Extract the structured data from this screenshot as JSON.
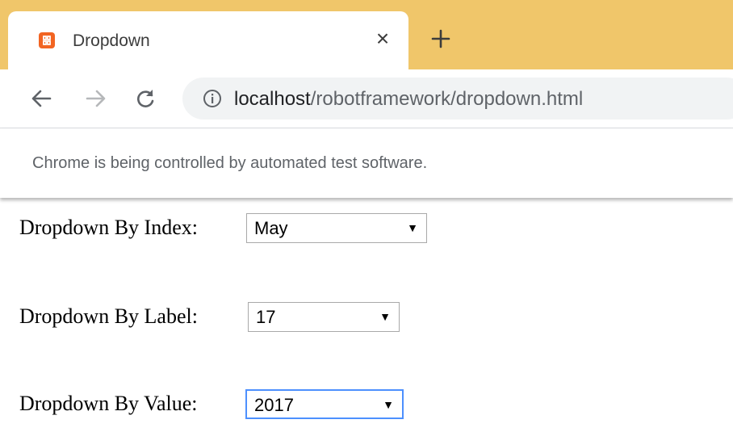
{
  "browser": {
    "tab": {
      "title": "Dropdown",
      "close_symbol": "×",
      "favicon_icon": "xampp-icon",
      "favicon_color": "#f26422"
    },
    "new_tab_icon": "plus-icon",
    "frame_color": "#f0c66a",
    "toolbar": {
      "back_icon": "arrow-left-icon",
      "forward_icon": "arrow-right-icon",
      "reload_icon": "reload-icon",
      "info_icon": "info-icon",
      "url_host": "localhost",
      "url_path": "/robotframework/dropdown.html"
    },
    "infobar": {
      "text": "Chrome is being controlled by automated test software."
    }
  },
  "page": {
    "dropdown_index": {
      "label": "Dropdown By Index:",
      "selected": "May"
    },
    "dropdown_label": {
      "label": "Dropdown By Label:",
      "selected": "17"
    },
    "dropdown_value": {
      "label": "Dropdown By Value:",
      "selected": "2017",
      "focused": true
    }
  },
  "select_arrow": "▼",
  "focus_color": "#4d90fe"
}
